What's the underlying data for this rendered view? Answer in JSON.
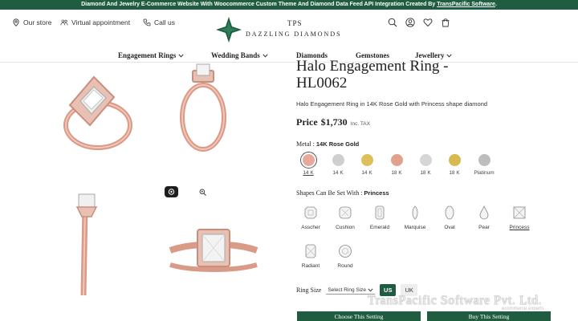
{
  "top_banner": {
    "text": "Diamond And Jewelry E-Commerce Website With Woocommerce Custom Theme And Diamond Data Feed API Integration Created By ",
    "link": "TransPacific Software",
    "suffix": "."
  },
  "header": {
    "our_store": "Our store",
    "virtual_appointment": "Virtual appointment",
    "call_us": "Call us",
    "logo_top": "TPS",
    "logo_name": "DAZZLING DIAMONDS",
    "icons": [
      "search-icon",
      "account-icon",
      "wishlist-icon",
      "cart-icon"
    ]
  },
  "nav": [
    {
      "label": "Engagement Rings",
      "dropdown": true
    },
    {
      "label": "Wedding Bands",
      "dropdown": true
    },
    {
      "label": "Diamonds",
      "dropdown": false
    },
    {
      "label": "Gemstones",
      "dropdown": false
    },
    {
      "label": "Jewellery",
      "dropdown": true
    }
  ],
  "product": {
    "title_line1": "Halo Engagement Ring -",
    "title_line2": "HL0062",
    "subtitle": "Halo Engagement Ring in 14K Rose Gold with Princess shape diamond",
    "price_label": "Price",
    "price_value": "$1,730",
    "price_tax": "Inc. TAX",
    "metal_label": "Metal :",
    "metal_selected": "14K Rose Gold",
    "metals": [
      {
        "karat": "14 K",
        "color": "#e8a99a",
        "selected": true
      },
      {
        "karat": "14 K",
        "color": "#cfcfcf",
        "selected": false
      },
      {
        "karat": "14 K",
        "color": "#dcbf5a",
        "selected": false
      },
      {
        "karat": "18 K",
        "color": "#e3a08c",
        "selected": false
      },
      {
        "karat": "18 K",
        "color": "#d6d6d6",
        "selected": false
      },
      {
        "karat": "18 K",
        "color": "#d8b94e",
        "selected": false
      },
      {
        "karat": "Platinum",
        "color": "#bdbdbd",
        "selected": false
      }
    ],
    "shapes_label": "Shapes Can Be Set With :",
    "shape_selected": "Princess",
    "shapes": [
      "Asscher",
      "Cushion",
      "Emerald",
      "Marquise",
      "Oval",
      "Pear",
      "Princess",
      "Radiant",
      "Round"
    ],
    "ring_size_label": "Ring Size",
    "ring_size_placeholder": "Select Ring Size",
    "unit_us": "US",
    "unit_uk": "UK",
    "choose_setting": "Choose This Setting",
    "buy_setting": "Buy This Setting"
  },
  "watermark": {
    "text": "TransPacific Software Pvt. Ltd.",
    "sub": "ecommerce experts"
  },
  "colors": {
    "brand_green": "#1f5c41",
    "rose_gold": "#e3a08c"
  }
}
